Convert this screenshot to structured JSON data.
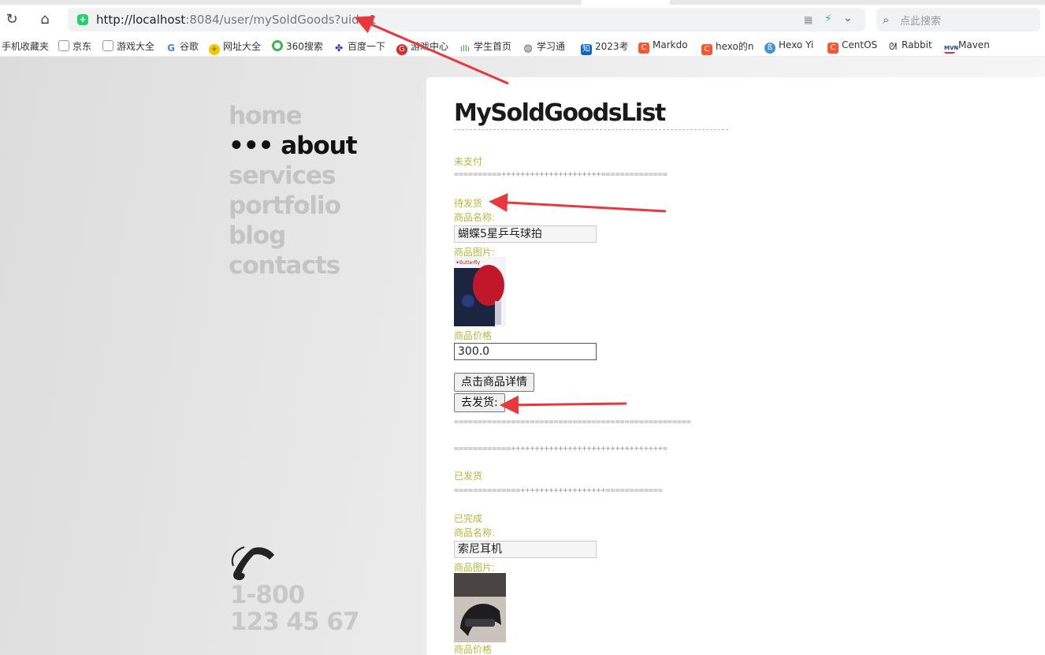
{
  "browser": {
    "url_host": "http://localhost",
    "url_rest": ":8084/user/mySoldGoods?uid=1",
    "search_placeholder": "点此搜索"
  },
  "bookmarks": [
    {
      "label": "手机收藏夹",
      "icon": "none"
    },
    {
      "label": "京东",
      "icon": "page-icon"
    },
    {
      "label": "游戏大全",
      "icon": "page-icon"
    },
    {
      "label": "谷歌",
      "icon": "google-icon"
    },
    {
      "label": "网址大全",
      "icon": "site-icon"
    },
    {
      "label": "360搜索",
      "icon": "360-icon"
    },
    {
      "label": "百度一下",
      "icon": "baidu-icon"
    },
    {
      "label": "游戏中心",
      "icon": "game-icon"
    },
    {
      "label": "学生首页",
      "icon": "wave-icon"
    },
    {
      "label": "学习通",
      "icon": "globe-icon"
    },
    {
      "label": "2023考",
      "icon": "zhihu-icon"
    },
    {
      "label": "Markdo",
      "icon": "c-icon"
    },
    {
      "label": "hexo的n",
      "icon": "c-icon"
    },
    {
      "label": "Hexo Yi",
      "icon": "hexo-icon"
    },
    {
      "label": "CentOS",
      "icon": "c-icon"
    },
    {
      "label": "Rabbit",
      "icon": "rabbit-icon"
    },
    {
      "label": "Maven",
      "icon": "mvn-icon"
    }
  ],
  "menu": {
    "items": [
      "home",
      "about",
      "services",
      "portfolio",
      "blog",
      "contacts"
    ],
    "active_prefix": "••• ",
    "active_index": 1
  },
  "phone": {
    "line1": "1-800",
    "line2": "123 45 67"
  },
  "main": {
    "title": "MySoldGoodsList",
    "status_unpaid": "未支付",
    "sep1": "==========+++++++++++++++++++++==============",
    "status_to_ship": "待发货",
    "name_label": "商品名称:",
    "item1_name": "蝴蝶5星乒乓球拍",
    "image_label": "商品图片:",
    "price_label": "商品价格",
    "item1_price": "300.0",
    "detail_button": "点击商品详情",
    "ship_button": "去发货:",
    "sep2": "==================================================",
    "sep3": "============++++++++++++++++++++++++++++++++=",
    "status_shipped": "已发货",
    "sep4": "==============++++++++++++++++++============",
    "status_done": "已完成",
    "item2_name": "索尼耳机"
  },
  "colors": {
    "accent_label": "#b3b83a",
    "arrow": "#e8383d"
  }
}
